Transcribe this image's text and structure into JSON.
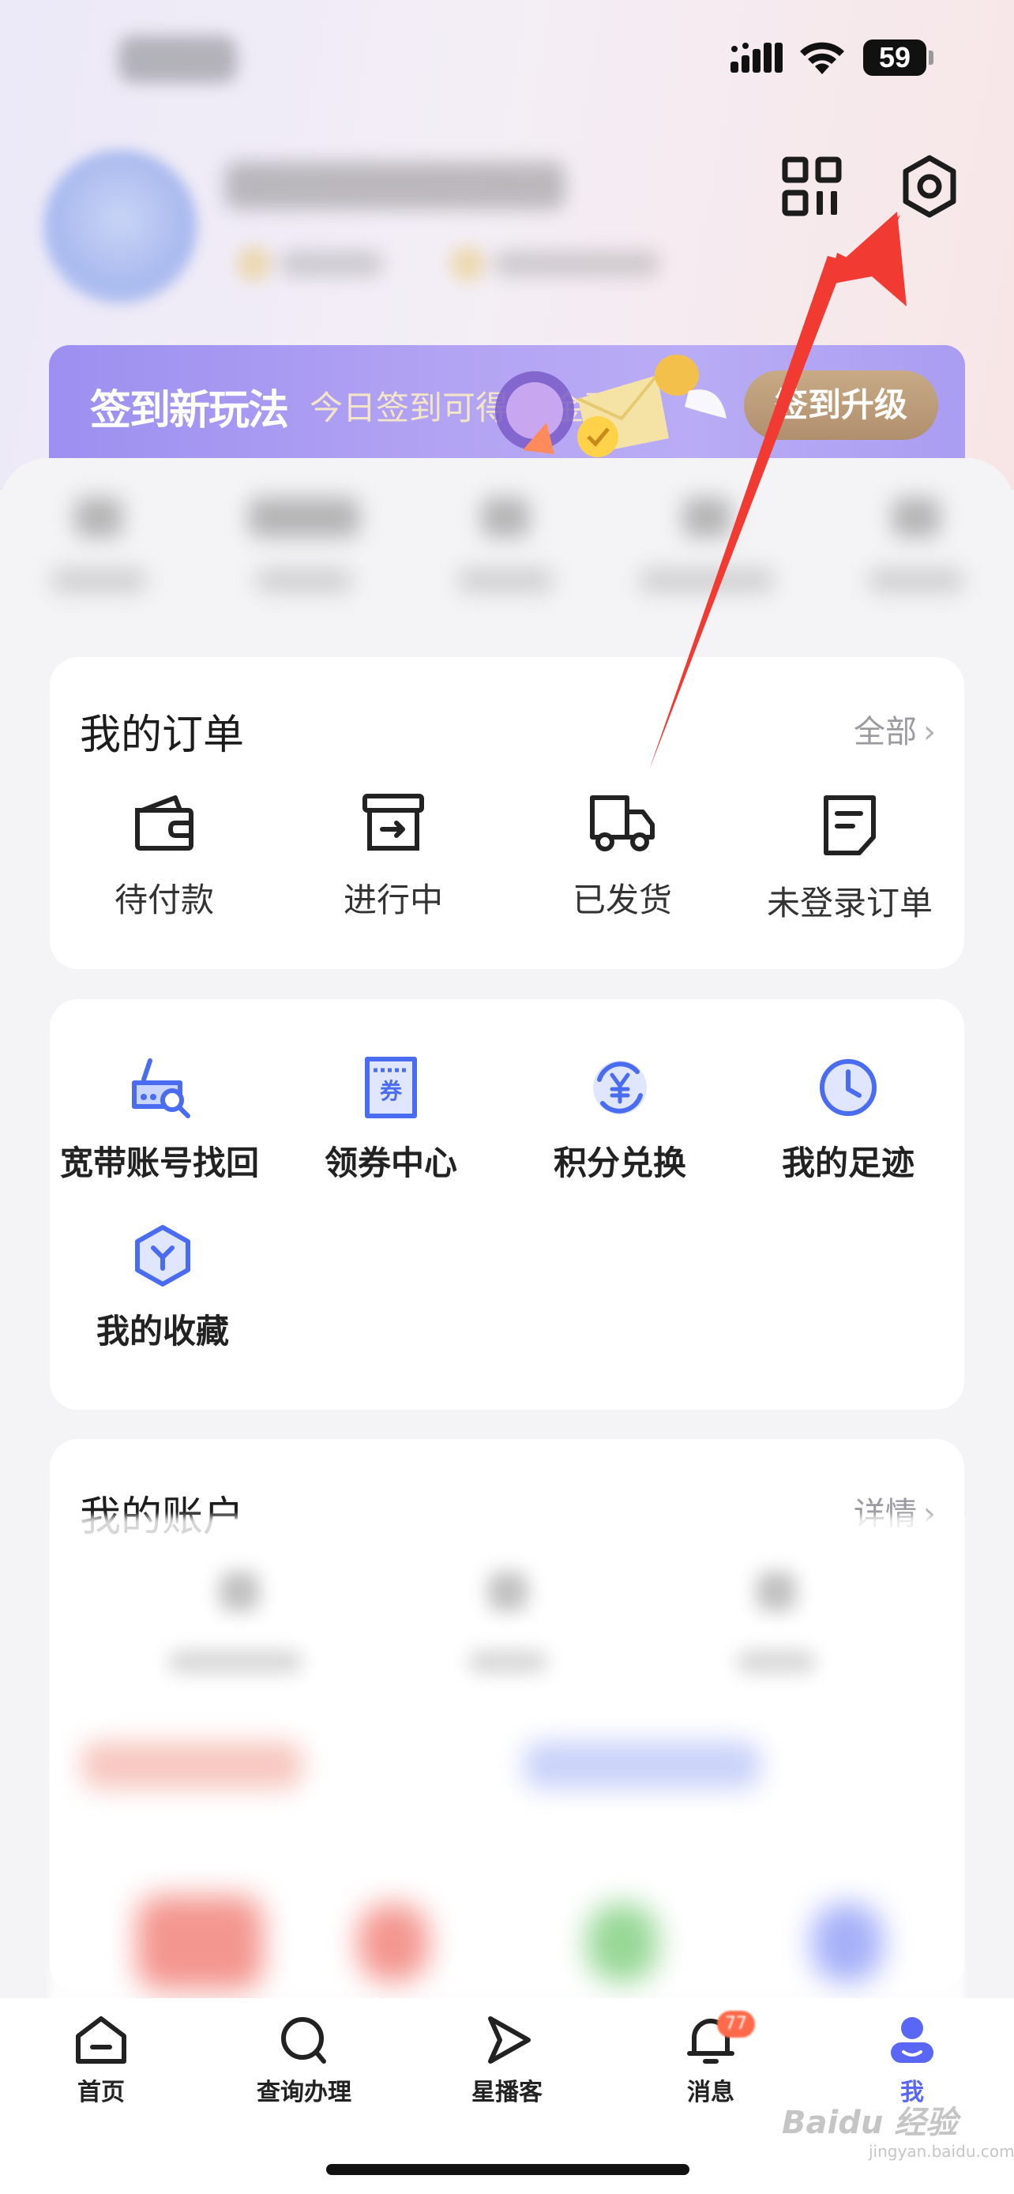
{
  "status_bar": {
    "battery": "59"
  },
  "banner": {
    "title": "签到新玩法",
    "subtitle": "今日签到可得20金豆",
    "button": "签到升级"
  },
  "orders": {
    "title": "我的订单",
    "more": "全部",
    "items": [
      {
        "label": "待付款",
        "icon": "wallet-icon"
      },
      {
        "label": "进行中",
        "icon": "archive-box-icon"
      },
      {
        "label": "已发货",
        "icon": "truck-icon"
      },
      {
        "label": "未登录订单",
        "icon": "document-icon"
      }
    ]
  },
  "tools": {
    "items": [
      {
        "label": "宽带账号找回",
        "icon": "router-search-icon"
      },
      {
        "label": "领券中心",
        "icon": "coupon-icon"
      },
      {
        "label": "积分兑换",
        "icon": "yen-exchange-icon"
      },
      {
        "label": "我的足迹",
        "icon": "clock-icon"
      },
      {
        "label": "我的收藏",
        "icon": "favorite-hexagon-icon"
      }
    ]
  },
  "account": {
    "title": "我的账户",
    "more": "详情"
  },
  "tabbar": {
    "items": [
      {
        "label": "首页",
        "icon": "home-icon"
      },
      {
        "label": "查询办理",
        "icon": "search-icon"
      },
      {
        "label": "星播客",
        "icon": "play-icon"
      },
      {
        "label": "消息",
        "icon": "bell-icon",
        "badge": "77"
      },
      {
        "label": "我",
        "icon": "profile-icon"
      }
    ],
    "active_color": "#5a67f5"
  },
  "watermark": {
    "text": "Baidu 经验",
    "sub": "jingyan.baidu.com"
  }
}
